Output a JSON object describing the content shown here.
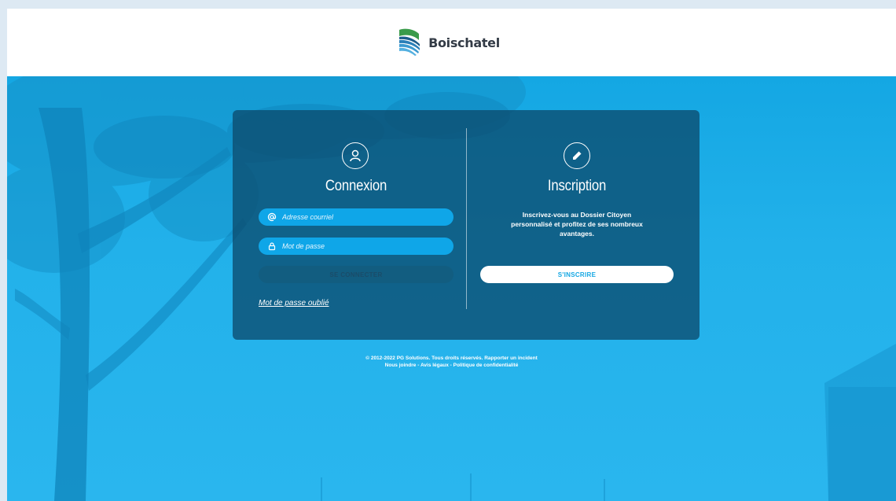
{
  "brand": {
    "name": "Boischatel"
  },
  "login": {
    "title": "Connexion",
    "email_placeholder": "Adresse courriel",
    "password_placeholder": "Mot de passe",
    "submit_label": "SE CONNECTER",
    "forgot_label": "Mot de passe oublié"
  },
  "signup": {
    "title": "Inscription",
    "description": "Inscrivez-vous au Dossier Citoyen personnalisé et profitez de ses nombreux avantages.",
    "button_label": "S'INSCRIRE"
  },
  "footer": {
    "copyright": "© 2012-2022 PG Solutions. Tous droits réservés.",
    "report_link": "Rapporter un incident",
    "contact_link": "Nous joindre",
    "legal_link": "Avis légaux",
    "privacy_link": "Politique de confidentialité",
    "separator": " - "
  },
  "icons": {
    "user": "user-icon",
    "pencil": "pencil-icon",
    "at": "at-icon",
    "lock": "lock-icon"
  },
  "colors": {
    "accent": "#14a7e3",
    "card": "#0c4b6e",
    "input": "#0fa6e8"
  }
}
